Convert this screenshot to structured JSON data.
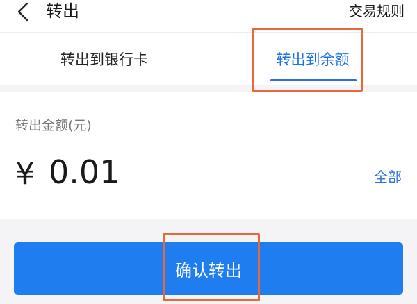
{
  "header": {
    "title": "转出",
    "rules_link": "交易规则",
    "back_icon": "chevron-left-icon"
  },
  "tabs": [
    {
      "label": "转出到银行卡",
      "active": false
    },
    {
      "label": "转出到余额",
      "active": true
    }
  ],
  "amount": {
    "label": "转出金额(元)",
    "currency_symbol": "¥",
    "value": "0.01",
    "all_link": "全部"
  },
  "confirm_button": {
    "label": "确认转出"
  },
  "colors": {
    "accent": "#2a6fe0",
    "button": "#1f7df0",
    "highlight": "#e8683c"
  }
}
